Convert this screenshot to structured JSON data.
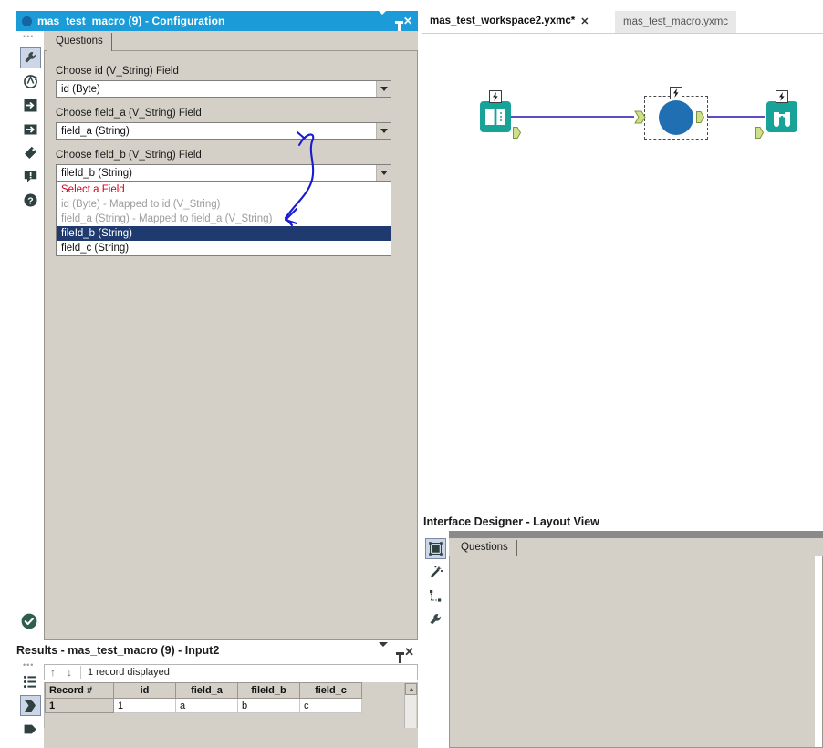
{
  "config_window": {
    "title": "mas_test_macro (9) - Configuration",
    "titlebar_buttons": {
      "minimize": "▼",
      "pin": "pin",
      "close": "✕"
    },
    "tab": "Questions",
    "rail_icons": [
      "wrench-icon",
      "annotation-icon",
      "input-icon",
      "output-icon",
      "tag-icon",
      "comment-alert-icon",
      "help-icon"
    ],
    "fields": [
      {
        "label": "Choose id (V_String) Field",
        "value": "id (Byte)"
      },
      {
        "label": "Choose field_a (V_String) Field",
        "value": "field_a (String)"
      },
      {
        "label": "Choose field_b (V_String) Field",
        "value": "fileId_b (String)"
      }
    ],
    "dropdown_options": [
      {
        "text": "Select a Field",
        "style": "head"
      },
      {
        "text": "id (Byte) - Mapped to id (V_String)",
        "style": "dim"
      },
      {
        "text": "field_a (String) - Mapped to field_a (V_String)",
        "style": "dim"
      },
      {
        "text": "fileId_b (String)",
        "style": "sel"
      },
      {
        "text": "field_c (String)",
        "style": "plain"
      }
    ],
    "status_icon": "check-circle-icon"
  },
  "canvas": {
    "tabs": [
      {
        "label": "mas_test_workspace2.yxmc*",
        "close": "✕",
        "active": true
      },
      {
        "label": "mas_test_macro.yxmc",
        "active": false
      }
    ],
    "nodes": [
      {
        "name": "input-data-node",
        "icon": "book-icon"
      },
      {
        "name": "macro-node",
        "icon": "macro-circle-icon"
      },
      {
        "name": "browse-node",
        "icon": "binoculars-icon"
      }
    ]
  },
  "interface_designer": {
    "title": "Interface Designer - Layout View",
    "tab": "Questions",
    "rail_icons": [
      "layout-view-icon",
      "magic-wand-icon",
      "tree-view-icon",
      "wrench-icon"
    ]
  },
  "results": {
    "title": "Results - mas_test_macro (9) - Input2",
    "titlebar_buttons": {
      "minimize": "▼",
      "pin": "pin",
      "close": "✕"
    },
    "toolbar": {
      "up": "↑",
      "down": "↓",
      "count": "1 record displayed"
    },
    "columns": [
      "Record #",
      "id",
      "field_a",
      "fileId_b",
      "field_c"
    ],
    "rows": [
      [
        "1",
        "1",
        "a",
        "b",
        "c"
      ]
    ]
  },
  "colors": {
    "title_blue": "#1b9cd8",
    "panel_gray": "#d4d0c8",
    "node_teal": "#17a398",
    "macro_blue": "#1f6fb2",
    "wire_purple": "#5b4fc4",
    "select_navy": "#1f3a6e",
    "annotation_blue": "#1a1ad0",
    "error_red": "#d0021b"
  }
}
